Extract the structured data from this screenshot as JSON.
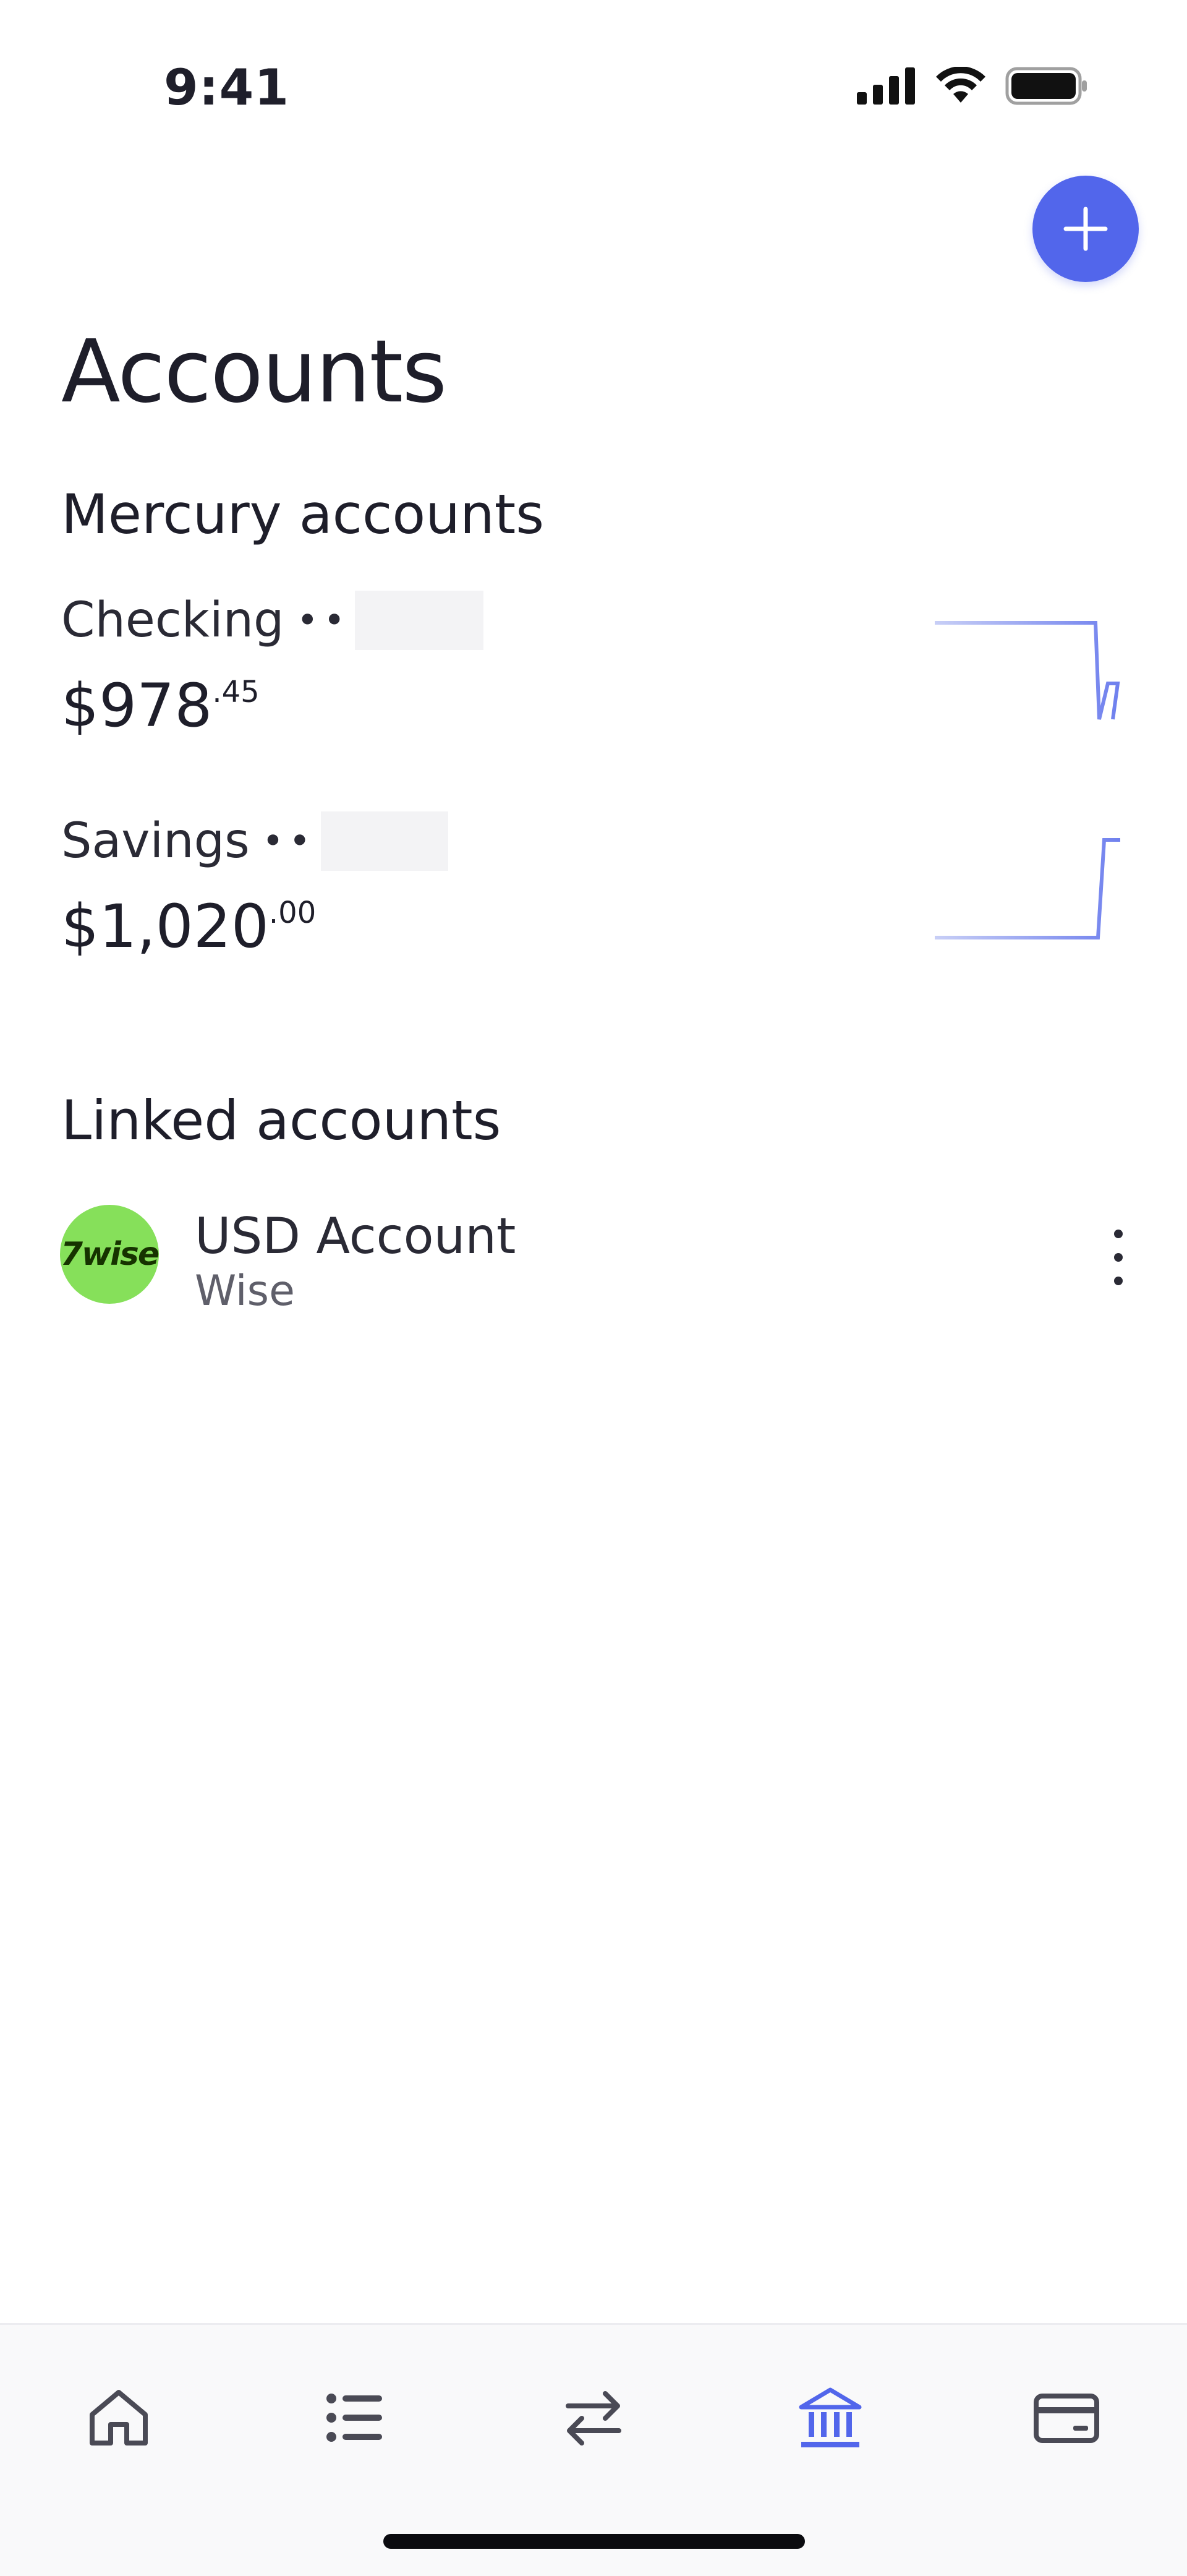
{
  "status_bar": {
    "time": "9:41"
  },
  "page": {
    "title": "Accounts"
  },
  "mercury": {
    "section_title": "Mercury accounts",
    "accounts": [
      {
        "name": "Checking",
        "mask": "••",
        "amount_main": "$978",
        "amount_cents": ".45"
      },
      {
        "name": "Savings",
        "mask": "••",
        "amount_main": "$1,020",
        "amount_cents": ".00"
      }
    ]
  },
  "linked": {
    "section_title": "Linked accounts",
    "items": [
      {
        "name": "USD Account",
        "provider": "Wise",
        "logo_text": "7wise"
      }
    ]
  },
  "colors": {
    "accent": "#5266eb",
    "wise_green": "#86e05a",
    "text": "#1e1e2a",
    "muted": "#5f5f6a"
  },
  "tabbar": {
    "tabs": [
      {
        "icon": "home-icon"
      },
      {
        "icon": "list-icon"
      },
      {
        "icon": "transfer-icon"
      },
      {
        "icon": "bank-icon",
        "active": true
      },
      {
        "icon": "card-icon"
      }
    ]
  }
}
